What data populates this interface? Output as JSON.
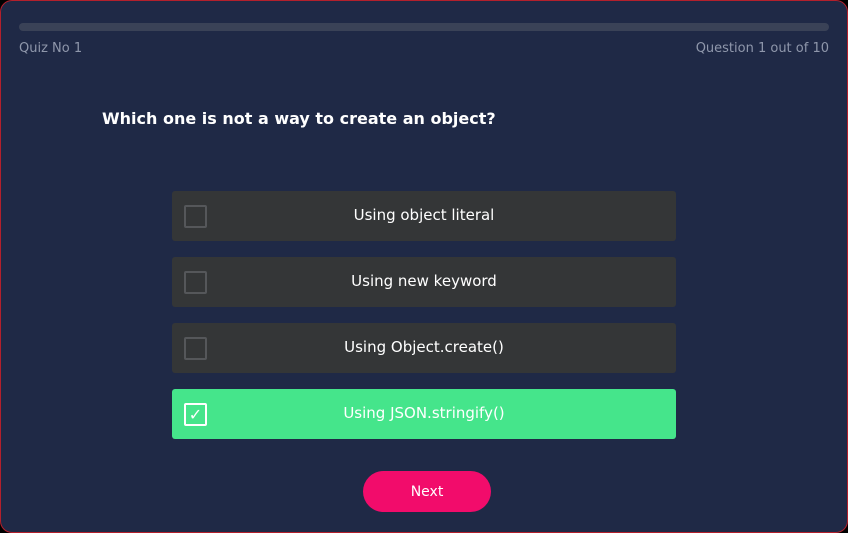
{
  "header": {
    "quiz_label": "Quiz No 1",
    "question_counter": "Question 1 out of 10",
    "progress": 0
  },
  "question": {
    "text": "Which one is not a way to create an object?"
  },
  "options": [
    {
      "label": "Using object literal",
      "checked": false
    },
    {
      "label": "Using new keyword",
      "checked": false
    },
    {
      "label": "Using Object.create()",
      "checked": false
    },
    {
      "label": "Using JSON.stringify()",
      "checked": true
    }
  ],
  "actions": {
    "next_label": "Next"
  },
  "colors": {
    "background": "#1f2946",
    "option_default": "#343637",
    "option_selected": "#45e58b",
    "next_button": "#f20c6b",
    "muted_text": "#8f97ab"
  }
}
